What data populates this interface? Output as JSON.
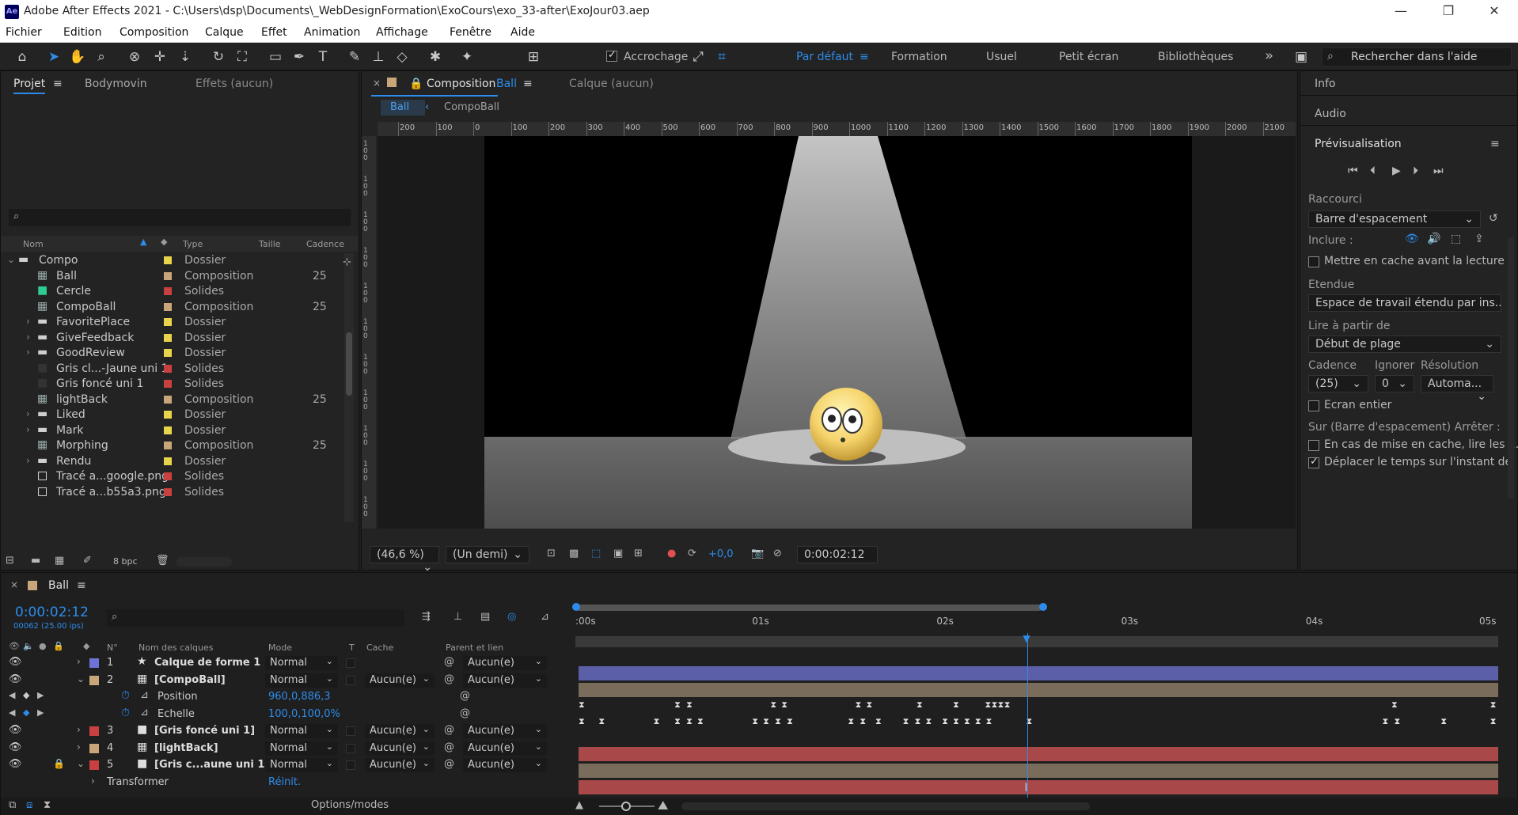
{
  "window": {
    "app_icon": "Ae",
    "title": "Adobe After Effects 2021 - C:\\Users\\dsp\\Documents\\_WebDesignFormation\\ExoCours\\exo_33-after\\ExoJour03.aep",
    "controls": [
      "—",
      "❐",
      "✕"
    ]
  },
  "menu": [
    "Fichier",
    "Edition",
    "Composition",
    "Calque",
    "Effet",
    "Animation",
    "Affichage",
    "Fenêtre",
    "Aide"
  ],
  "toolbar": {
    "snap_label": "Accrochage",
    "workspaces": [
      "Par défaut",
      "Formation",
      "Usuel",
      "Petit écran",
      "Bibliothèques"
    ],
    "more": "»",
    "search_placeholder": "Rechercher dans l'aide"
  },
  "project": {
    "tabs": [
      "Projet",
      "Bodymovin",
      "Effets  (aucun)"
    ],
    "columns": [
      "Nom",
      "Type",
      "Taille",
      "Cadence"
    ],
    "items": [
      {
        "name": "Compo",
        "type": "Dossier",
        "cadence": "",
        "icon": "folder-icon",
        "label": "#e8d44a",
        "expander": "⌄"
      },
      {
        "name": "Ball",
        "type": "Composition",
        "cadence": "25",
        "icon": "composition-icon",
        "label": "#c9a57a",
        "expander": ""
      },
      {
        "name": "Cercle",
        "type": "Solides",
        "cadence": "",
        "icon": "solid-icon",
        "label": "#c84040",
        "expander": ""
      },
      {
        "name": "CompoBall",
        "type": "Composition",
        "cadence": "25",
        "icon": "composition-icon",
        "label": "#c9a57a",
        "expander": ""
      },
      {
        "name": "FavoritePlace",
        "type": "Dossier",
        "cadence": "",
        "icon": "folder-icon",
        "label": "#e8d44a",
        "expander": "›"
      },
      {
        "name": "GiveFeedback",
        "type": "Dossier",
        "cadence": "",
        "icon": "folder-icon",
        "label": "#e8d44a",
        "expander": "›"
      },
      {
        "name": "GoodReview",
        "type": "Dossier",
        "cadence": "",
        "icon": "folder-icon",
        "label": "#e8d44a",
        "expander": "›"
      },
      {
        "name": "Gris cl...-Jaune uni 1",
        "type": "Solides",
        "cadence": "",
        "icon": "solid-icon",
        "label": "#c84040",
        "expander": ""
      },
      {
        "name": "Gris foncé uni 1",
        "type": "Solides",
        "cadence": "",
        "icon": "solid-icon",
        "label": "#c84040",
        "expander": ""
      },
      {
        "name": "lightBack",
        "type": "Composition",
        "cadence": "25",
        "icon": "composition-icon",
        "label": "#c9a57a",
        "expander": ""
      },
      {
        "name": "Liked",
        "type": "Dossier",
        "cadence": "",
        "icon": "folder-icon",
        "label": "#e8d44a",
        "expander": "›"
      },
      {
        "name": "Mark",
        "type": "Dossier",
        "cadence": "",
        "icon": "folder-icon",
        "label": "#e8d44a",
        "expander": "›"
      },
      {
        "name": "Morphing",
        "type": "Composition",
        "cadence": "25",
        "icon": "composition-icon",
        "label": "#c9a57a",
        "expander": ""
      },
      {
        "name": "Rendu",
        "type": "Dossier",
        "cadence": "",
        "icon": "folder-icon",
        "label": "#e8d44a",
        "expander": "›"
      },
      {
        "name": "Tracé a...google.png",
        "type": "Solides",
        "cadence": "",
        "icon": "image-icon",
        "label": "#c84040",
        "expander": ""
      },
      {
        "name": "Tracé a...b55a3.png",
        "type": "Solides",
        "cadence": "",
        "icon": "image-icon",
        "label": "#c84040",
        "expander": ""
      }
    ],
    "bpc": "8 bpc"
  },
  "composition": {
    "tab_title": "Composition",
    "tab_name": "Ball",
    "layer_tab": "Calque  (aucun)",
    "breadcrumb": [
      "Ball",
      "CompoBall"
    ],
    "ruler": [
      "200",
      "100",
      "0",
      "100",
      "200",
      "300",
      "400",
      "500",
      "600",
      "700",
      "800",
      "900",
      "1000",
      "1100",
      "1200",
      "1300",
      "1400",
      "1500",
      "1600",
      "1700",
      "1800",
      "1900",
      "2000",
      "2100"
    ],
    "vruler_tick_count": 11,
    "zoom": "(46,6 %)",
    "resolution": "(Un demi)",
    "exposure": "+0,0",
    "timecode": "0:00:02:12"
  },
  "right_panel": {
    "sections": [
      "Info",
      "Audio",
      "Prévisualisation"
    ],
    "shortcut_label": "Raccourci",
    "shortcut_value": "Barre d'espacement",
    "include_label": "Inclure :",
    "cache_label": "Mettre en cache avant la lecture",
    "range_label": "Etendue",
    "range_value": "Espace de travail étendu par ins...",
    "play_from_label": "Lire à partir de",
    "play_from_value": "Début de plage",
    "cadence_label": "Cadence",
    "ignore_label": "Ignorer",
    "resolution_label": "Résolution",
    "cadence_value": "(25)",
    "ignore_value": "0",
    "resolution_value": "Automa...",
    "fullscreen_label": "Ecran entier",
    "stop_label": "Sur (Barre d'espacement) Arrêter :",
    "stop_opt1": "En cas de mise en cache, lire les ...",
    "stop_opt2": "Déplacer le temps sur l'instant de pré"
  },
  "timeline": {
    "tab": "Ball",
    "timecode": "0:00:02:12",
    "frame_info": "00062 (25.00 ips)",
    "columns": {
      "num": "N°",
      "name": "Nom des calques",
      "mode": "Mode",
      "t": "T",
      "cache": "Cache",
      "parent": "Parent et lien"
    },
    "time_labels": [
      ":00s",
      "01s",
      "02s",
      "03s",
      "04s",
      "05s"
    ],
    "playhead": 0.49,
    "layers": [
      {
        "num": "1",
        "name": "Calque de forme 1",
        "mode": "Normal",
        "cache": "",
        "parent": "Aucun(e)",
        "label": "#6f73d8",
        "bar": "#5a5fa8",
        "icon": "star-icon",
        "expander": "›"
      },
      {
        "num": "2",
        "name": "[CompoBall]",
        "mode": "Normal",
        "cache": "Aucun(e)",
        "parent": "Aucun(e)",
        "label": "#c9a57a",
        "bar": "#7a6c5b",
        "icon": "composition-icon",
        "expander": "⌄"
      },
      {
        "num": "3",
        "name": "[Gris foncé uni 1]",
        "mode": "Normal",
        "cache": "Aucun(e)",
        "parent": "Aucun(e)",
        "label": "#c84040",
        "bar": "#a84848",
        "icon": "solid-icon",
        "expander": "›"
      },
      {
        "num": "4",
        "name": "[lightBack]",
        "mode": "Normal",
        "cache": "Aucun(e)",
        "parent": "Aucun(e)",
        "label": "#c9a57a",
        "bar": "#7a6c5b",
        "icon": "composition-icon",
        "expander": "›"
      },
      {
        "num": "5",
        "name": "[Gris c...aune uni 1]",
        "mode": "Normal",
        "cache": "Aucun(e)",
        "parent": "Aucun(e)",
        "label": "#c84040",
        "bar": "#a84848",
        "icon": "solid-icon",
        "expander": "⌄"
      }
    ],
    "props": [
      {
        "name": "Position",
        "value": "960,0,886,3"
      },
      {
        "name": "Echelle",
        "value": "100,0,100,0%"
      }
    ],
    "transform_label": "Transformer",
    "reset_label": "Réinit.",
    "options_label": "Options/modes",
    "keyframes_pos": [
      0.0,
      0.105,
      0.118,
      0.21,
      0.222,
      0.303,
      0.315,
      0.37,
      0.41,
      0.445,
      0.452,
      0.459,
      0.466,
      0.89,
      0.998
    ],
    "keyframes_scale": [
      0.0,
      0.022,
      0.082,
      0.105,
      0.118,
      0.13,
      0.19,
      0.202,
      0.215,
      0.228,
      0.295,
      0.308,
      0.325,
      0.355,
      0.368,
      0.38,
      0.398,
      0.41,
      0.422,
      0.434,
      0.446,
      0.49,
      0.88,
      0.893,
      0.944,
      0.998
    ]
  },
  "colors": {
    "accent": "#2d8ceb",
    "panel": "#232323",
    "dark": "#1d1d1d"
  }
}
